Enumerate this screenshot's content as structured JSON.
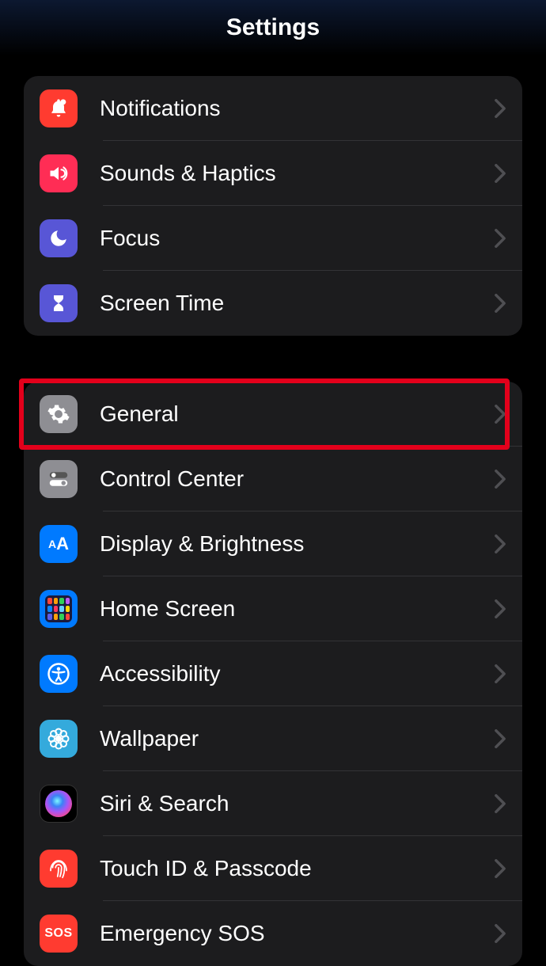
{
  "header": {
    "title": "Settings"
  },
  "groups": [
    {
      "rows": [
        {
          "id": "notifications",
          "label": "Notifications",
          "icon": "bell-icon",
          "bg": "bg-red"
        },
        {
          "id": "sounds",
          "label": "Sounds & Haptics",
          "icon": "speaker-icon",
          "bg": "bg-pink"
        },
        {
          "id": "focus",
          "label": "Focus",
          "icon": "moon-icon",
          "bg": "bg-indigo"
        },
        {
          "id": "screentime",
          "label": "Screen Time",
          "icon": "hourglass-icon",
          "bg": "bg-indigo"
        }
      ]
    },
    {
      "rows": [
        {
          "id": "general",
          "label": "General",
          "icon": "gear-icon",
          "bg": "bg-gray",
          "highlighted": true
        },
        {
          "id": "controlcenter",
          "label": "Control Center",
          "icon": "switches-icon",
          "bg": "bg-gray"
        },
        {
          "id": "display",
          "label": "Display & Brightness",
          "icon": "aa-icon",
          "bg": "bg-blue"
        },
        {
          "id": "homescreen",
          "label": "Home Screen",
          "icon": "grid-icon",
          "bg": "bg-blue"
        },
        {
          "id": "accessibility",
          "label": "Accessibility",
          "icon": "accessibility-icon",
          "bg": "bg-blue"
        },
        {
          "id": "wallpaper",
          "label": "Wallpaper",
          "icon": "flower-icon",
          "bg": "bg-sky"
        },
        {
          "id": "siri",
          "label": "Siri & Search",
          "icon": "siri-icon",
          "bg": "bg-siri"
        },
        {
          "id": "touchid",
          "label": "Touch ID & Passcode",
          "icon": "fingerprint-icon",
          "bg": "bg-red"
        },
        {
          "id": "emergency",
          "label": "Emergency SOS",
          "icon": "sos-icon",
          "bg": "bg-emerg",
          "sos_text": "SOS"
        }
      ]
    }
  ],
  "colors": {
    "highlight": "#e3001b"
  }
}
